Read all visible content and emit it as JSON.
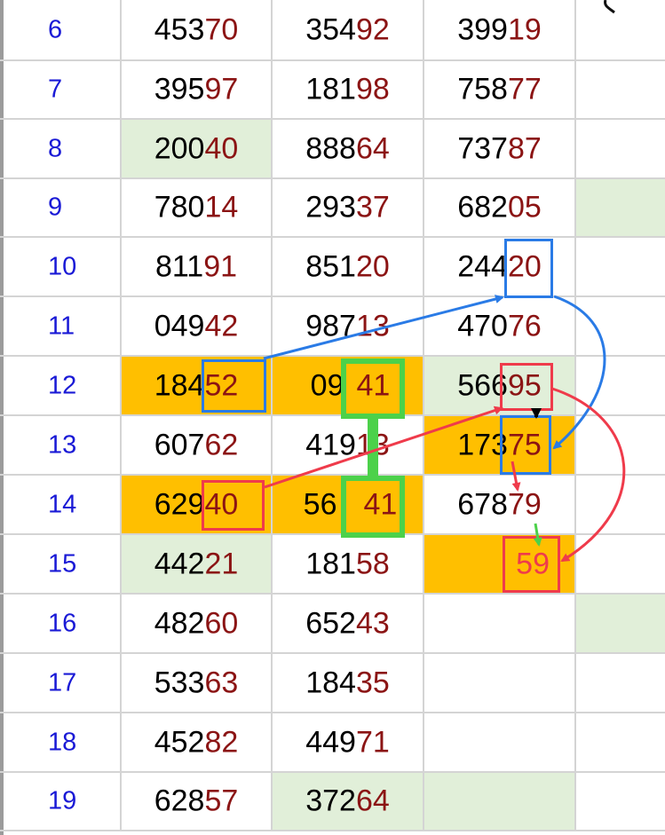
{
  "sheet": {
    "rows": [
      {
        "num": "6",
        "cells": [
          {
            "pre": "453",
            "hi": "70"
          },
          {
            "pre": "354",
            "hi": "92"
          },
          {
            "pre": "399",
            "hi": "19"
          },
          {
            "pre": "",
            "hi": ""
          }
        ]
      },
      {
        "num": "7",
        "cells": [
          {
            "pre": "395",
            "hi": "97"
          },
          {
            "pre": "181",
            "hi": "98"
          },
          {
            "pre": "758",
            "hi": "77"
          },
          {
            "pre": "",
            "hi": ""
          }
        ]
      },
      {
        "num": "8",
        "cells": [
          {
            "pre": "200",
            "hi": "40"
          },
          {
            "pre": "888",
            "hi": "64"
          },
          {
            "pre": "737",
            "hi": "87"
          },
          {
            "pre": "",
            "hi": ""
          }
        ]
      },
      {
        "num": "9",
        "cells": [
          {
            "pre": "780",
            "hi": "14"
          },
          {
            "pre": "293",
            "hi": "37"
          },
          {
            "pre": "682",
            "hi": "05"
          },
          {
            "pre": "",
            "hi": ""
          }
        ]
      },
      {
        "num": "10",
        "cells": [
          {
            "pre": "811",
            "hi": "91"
          },
          {
            "pre": "851",
            "hi": "20"
          },
          {
            "pre": "244",
            "hi": "20"
          },
          {
            "pre": "",
            "hi": ""
          }
        ]
      },
      {
        "num": "11",
        "cells": [
          {
            "pre": "049",
            "hi": "42"
          },
          {
            "pre": "987",
            "hi": "13"
          },
          {
            "pre": "470",
            "hi": "76"
          },
          {
            "pre": "",
            "hi": ""
          }
        ]
      },
      {
        "num": "12",
        "cells": [
          {
            "pre": "184",
            "hi": "52"
          },
          {
            "pre": "09",
            "hi": "41"
          },
          {
            "pre": "566",
            "hi": "95"
          },
          {
            "pre": "",
            "hi": ""
          }
        ]
      },
      {
        "num": "13",
        "cells": [
          {
            "pre": "607",
            "hi": "62"
          },
          {
            "pre": "419",
            "hi": "13"
          },
          {
            "pre": "173",
            "hi": "75"
          },
          {
            "pre": "",
            "hi": ""
          }
        ]
      },
      {
        "num": "14",
        "cells": [
          {
            "pre": "629",
            "hi": "40"
          },
          {
            "pre": "56",
            "hi": "41"
          },
          {
            "pre": "678",
            "hi": "79"
          },
          {
            "pre": "",
            "hi": ""
          }
        ]
      },
      {
        "num": "15",
        "cells": [
          {
            "pre": "442",
            "hi": "21"
          },
          {
            "pre": "181",
            "hi": "58"
          },
          {
            "pre": "",
            "hi": "59"
          },
          {
            "pre": "",
            "hi": ""
          }
        ]
      },
      {
        "num": "16",
        "cells": [
          {
            "pre": "482",
            "hi": "60"
          },
          {
            "pre": "652",
            "hi": "43"
          },
          {
            "pre": "",
            "hi": ""
          },
          {
            "pre": "",
            "hi": ""
          }
        ]
      },
      {
        "num": "17",
        "cells": [
          {
            "pre": "533",
            "hi": "63"
          },
          {
            "pre": "184",
            "hi": "35"
          },
          {
            "pre": "",
            "hi": ""
          },
          {
            "pre": "",
            "hi": ""
          }
        ]
      },
      {
        "num": "18",
        "cells": [
          {
            "pre": "452",
            "hi": "82"
          },
          {
            "pre": "449",
            "hi": "71"
          },
          {
            "pre": "",
            "hi": ""
          },
          {
            "pre": "",
            "hi": ""
          }
        ]
      },
      {
        "num": "19",
        "cells": [
          {
            "pre": "628",
            "hi": "57"
          },
          {
            "pre": "372",
            "hi": "64"
          },
          {
            "pre": "",
            "hi": ""
          },
          {
            "pre": "",
            "hi": ""
          }
        ]
      }
    ]
  },
  "colors": {
    "row_number": "#1a1ad6",
    "highlight_digits": "#8b1414",
    "orange_fill": "#ffbf00",
    "green_fill": "#e1efd9",
    "annotation_blue": "#2a7be6",
    "annotation_red": "#ef3b4b",
    "annotation_green": "#4cd14a"
  }
}
